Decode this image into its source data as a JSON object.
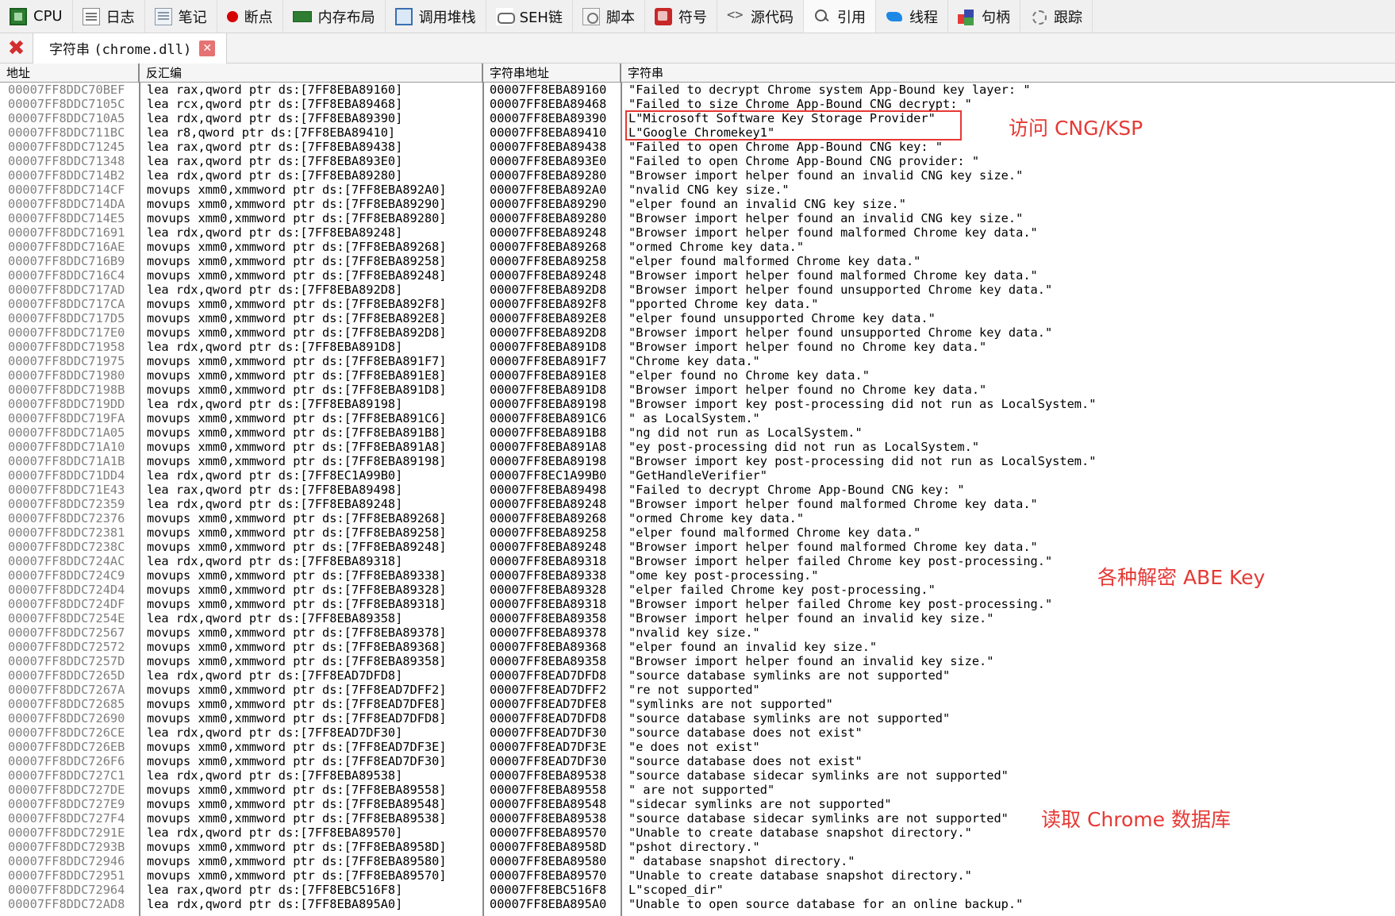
{
  "toolbar": {
    "tabs": [
      {
        "id": "cpu",
        "label": "CPU",
        "icon": "cpu-icon"
      },
      {
        "id": "log",
        "label": "日志",
        "icon": "log-icon"
      },
      {
        "id": "notes",
        "label": "笔记",
        "icon": "notes-icon"
      },
      {
        "id": "breakpoints",
        "label": "断点",
        "icon": "breakpoint-icon"
      },
      {
        "id": "memory",
        "label": "内存布局",
        "icon": "memory-map-icon"
      },
      {
        "id": "callstack",
        "label": "调用堆栈",
        "icon": "callstack-icon"
      },
      {
        "id": "seh",
        "label": "SEH链",
        "icon": "seh-chain-icon"
      },
      {
        "id": "script",
        "label": "脚本",
        "icon": "script-icon"
      },
      {
        "id": "symbols",
        "label": "符号",
        "icon": "symbols-icon"
      },
      {
        "id": "source",
        "label": "源代码",
        "icon": "source-code-icon"
      },
      {
        "id": "references",
        "label": "引用",
        "icon": "references-icon"
      },
      {
        "id": "threads",
        "label": "线程",
        "icon": "threads-icon"
      },
      {
        "id": "handles",
        "label": "句柄",
        "icon": "handles-icon"
      },
      {
        "id": "trace",
        "label": "跟踪",
        "icon": "trace-icon"
      }
    ],
    "active_tab": "references"
  },
  "subtab": {
    "label_prefix": "字符串 ",
    "label_module": "(chrome.dll)"
  },
  "columns": {
    "address": "地址",
    "disassembly": "反汇编",
    "string_address": "字符串地址",
    "string": "字符串"
  },
  "rows": [
    [
      "00007FF8DDC70BEF",
      "lea rax,qword ptr ds:[7FF8EBA89160]",
      "00007FF8EBA89160",
      "\"Failed to decrypt Chrome system App-Bound key layer: \""
    ],
    [
      "00007FF8DDC7105C",
      "lea rcx,qword ptr ds:[7FF8EBA89468]",
      "00007FF8EBA89468",
      "\"Failed to size Chrome App-Bound CNG decrypt: \""
    ],
    [
      "00007FF8DDC710A5",
      "lea rdx,qword ptr ds:[7FF8EBA89390]",
      "00007FF8EBA89390",
      "L\"Microsoft Software Key Storage Provider\""
    ],
    [
      "00007FF8DDC711BC",
      "lea r8,qword ptr ds:[7FF8EBA89410]",
      "00007FF8EBA89410",
      "L\"Google Chromekey1\""
    ],
    [
      "00007FF8DDC71245",
      "lea rax,qword ptr ds:[7FF8EBA89438]",
      "00007FF8EBA89438",
      "\"Failed to open Chrome App-Bound CNG key: \""
    ],
    [
      "00007FF8DDC71348",
      "lea rax,qword ptr ds:[7FF8EBA893E0]",
      "00007FF8EBA893E0",
      "\"Failed to open Chrome App-Bound CNG provider: \""
    ],
    [
      "00007FF8DDC714B2",
      "lea rdx,qword ptr ds:[7FF8EBA89280]",
      "00007FF8EBA89280",
      "\"Browser import helper found an invalid CNG key size.\""
    ],
    [
      "00007FF8DDC714CF",
      "movups xmm0,xmmword ptr ds:[7FF8EBA892A0]",
      "00007FF8EBA892A0",
      "\"nvalid CNG key size.\""
    ],
    [
      "00007FF8DDC714DA",
      "movups xmm0,xmmword ptr ds:[7FF8EBA89290]",
      "00007FF8EBA89290",
      "\"elper found an invalid CNG key size.\""
    ],
    [
      "00007FF8DDC714E5",
      "movups xmm0,xmmword ptr ds:[7FF8EBA89280]",
      "00007FF8EBA89280",
      "\"Browser import helper found an invalid CNG key size.\""
    ],
    [
      "00007FF8DDC71691",
      "lea rdx,qword ptr ds:[7FF8EBA89248]",
      "00007FF8EBA89248",
      "\"Browser import helper found malformed Chrome key data.\""
    ],
    [
      "00007FF8DDC716AE",
      "movups xmm0,xmmword ptr ds:[7FF8EBA89268]",
      "00007FF8EBA89268",
      "\"ormed Chrome key data.\""
    ],
    [
      "00007FF8DDC716B9",
      "movups xmm0,xmmword ptr ds:[7FF8EBA89258]",
      "00007FF8EBA89258",
      "\"elper found malformed Chrome key data.\""
    ],
    [
      "00007FF8DDC716C4",
      "movups xmm0,xmmword ptr ds:[7FF8EBA89248]",
      "00007FF8EBA89248",
      "\"Browser import helper found malformed Chrome key data.\""
    ],
    [
      "00007FF8DDC717AD",
      "lea rdx,qword ptr ds:[7FF8EBA892D8]",
      "00007FF8EBA892D8",
      "\"Browser import helper found unsupported Chrome key data.\""
    ],
    [
      "00007FF8DDC717CA",
      "movups xmm0,xmmword ptr ds:[7FF8EBA892F8]",
      "00007FF8EBA892F8",
      "\"pported Chrome key data.\""
    ],
    [
      "00007FF8DDC717D5",
      "movups xmm0,xmmword ptr ds:[7FF8EBA892E8]",
      "00007FF8EBA892E8",
      "\"elper found unsupported Chrome key data.\""
    ],
    [
      "00007FF8DDC717E0",
      "movups xmm0,xmmword ptr ds:[7FF8EBA892D8]",
      "00007FF8EBA892D8",
      "\"Browser import helper found unsupported Chrome key data.\""
    ],
    [
      "00007FF8DDC71958",
      "lea rdx,qword ptr ds:[7FF8EBA891D8]",
      "00007FF8EBA891D8",
      "\"Browser import helper found no Chrome key data.\""
    ],
    [
      "00007FF8DDC71975",
      "movups xmm0,xmmword ptr ds:[7FF8EBA891F7]",
      "00007FF8EBA891F7",
      "\"Chrome key data.\""
    ],
    [
      "00007FF8DDC71980",
      "movups xmm0,xmmword ptr ds:[7FF8EBA891E8]",
      "00007FF8EBA891E8",
      "\"elper found no Chrome key data.\""
    ],
    [
      "00007FF8DDC7198B",
      "movups xmm0,xmmword ptr ds:[7FF8EBA891D8]",
      "00007FF8EBA891D8",
      "\"Browser import helper found no Chrome key data.\""
    ],
    [
      "00007FF8DDC719DD",
      "lea rdx,qword ptr ds:[7FF8EBA89198]",
      "00007FF8EBA89198",
      "\"Browser import key post-processing did not run as LocalSystem.\""
    ],
    [
      "00007FF8DDC719FA",
      "movups xmm0,xmmword ptr ds:[7FF8EBA891C6]",
      "00007FF8EBA891C6",
      "\" as LocalSystem.\""
    ],
    [
      "00007FF8DDC71A05",
      "movups xmm0,xmmword ptr ds:[7FF8EBA891B8]",
      "00007FF8EBA891B8",
      "\"ng did not run as LocalSystem.\""
    ],
    [
      "00007FF8DDC71A10",
      "movups xmm0,xmmword ptr ds:[7FF8EBA891A8]",
      "00007FF8EBA891A8",
      "\"ey post-processing did not run as LocalSystem.\""
    ],
    [
      "00007FF8DDC71A1B",
      "movups xmm0,xmmword ptr ds:[7FF8EBA89198]",
      "00007FF8EBA89198",
      "\"Browser import key post-processing did not run as LocalSystem.\""
    ],
    [
      "00007FF8DDC71DD4",
      "lea rdx,qword ptr ds:[7FF8EC1A99B0]",
      "00007FF8EC1A99B0",
      "\"GetHandleVerifier\""
    ],
    [
      "00007FF8DDC71E43",
      "lea rax,qword ptr ds:[7FF8EBA89498]",
      "00007FF8EBA89498",
      "\"Failed to decrypt Chrome App-Bound CNG key: \""
    ],
    [
      "00007FF8DDC72359",
      "lea rdx,qword ptr ds:[7FF8EBA89248]",
      "00007FF8EBA89248",
      "\"Browser import helper found malformed Chrome key data.\""
    ],
    [
      "00007FF8DDC72376",
      "movups xmm0,xmmword ptr ds:[7FF8EBA89268]",
      "00007FF8EBA89268",
      "\"ormed Chrome key data.\""
    ],
    [
      "00007FF8DDC72381",
      "movups xmm0,xmmword ptr ds:[7FF8EBA89258]",
      "00007FF8EBA89258",
      "\"elper found malformed Chrome key data.\""
    ],
    [
      "00007FF8DDC7238C",
      "movups xmm0,xmmword ptr ds:[7FF8EBA89248]",
      "00007FF8EBA89248",
      "\"Browser import helper found malformed Chrome key data.\""
    ],
    [
      "00007FF8DDC724AC",
      "lea rdx,qword ptr ds:[7FF8EBA89318]",
      "00007FF8EBA89318",
      "\"Browser import helper failed Chrome key post-processing.\""
    ],
    [
      "00007FF8DDC724C9",
      "movups xmm0,xmmword ptr ds:[7FF8EBA89338]",
      "00007FF8EBA89338",
      "\"ome key post-processing.\""
    ],
    [
      "00007FF8DDC724D4",
      "movups xmm0,xmmword ptr ds:[7FF8EBA89328]",
      "00007FF8EBA89328",
      "\"elper failed Chrome key post-processing.\""
    ],
    [
      "00007FF8DDC724DF",
      "movups xmm0,xmmword ptr ds:[7FF8EBA89318]",
      "00007FF8EBA89318",
      "\"Browser import helper failed Chrome key post-processing.\""
    ],
    [
      "00007FF8DDC7254E",
      "lea rdx,qword ptr ds:[7FF8EBA89358]",
      "00007FF8EBA89358",
      "\"Browser import helper found an invalid key size.\""
    ],
    [
      "00007FF8DDC72567",
      "movups xmm0,xmmword ptr ds:[7FF8EBA89378]",
      "00007FF8EBA89378",
      "\"nvalid key size.\""
    ],
    [
      "00007FF8DDC72572",
      "movups xmm0,xmmword ptr ds:[7FF8EBA89368]",
      "00007FF8EBA89368",
      "\"elper found an invalid key size.\""
    ],
    [
      "00007FF8DDC7257D",
      "movups xmm0,xmmword ptr ds:[7FF8EBA89358]",
      "00007FF8EBA89358",
      "\"Browser import helper found an invalid key size.\""
    ],
    [
      "00007FF8DDC7265D",
      "lea rdx,qword ptr ds:[7FF8EAD7DFD8]",
      "00007FF8EAD7DFD8",
      "\"source database symlinks are not supported\""
    ],
    [
      "00007FF8DDC7267A",
      "movups xmm0,xmmword ptr ds:[7FF8EAD7DFF2]",
      "00007FF8EAD7DFF2",
      "\"re not supported\""
    ],
    [
      "00007FF8DDC72685",
      "movups xmm0,xmmword ptr ds:[7FF8EAD7DFE8]",
      "00007FF8EAD7DFE8",
      "\"symlinks are not supported\""
    ],
    [
      "00007FF8DDC72690",
      "movups xmm0,xmmword ptr ds:[7FF8EAD7DFD8]",
      "00007FF8EAD7DFD8",
      "\"source database symlinks are not supported\""
    ],
    [
      "00007FF8DDC726CE",
      "lea rdx,qword ptr ds:[7FF8EAD7DF30]",
      "00007FF8EAD7DF30",
      "\"source database does not exist\""
    ],
    [
      "00007FF8DDC726EB",
      "movups xmm0,xmmword ptr ds:[7FF8EAD7DF3E]",
      "00007FF8EAD7DF3E",
      "\"e does not exist\""
    ],
    [
      "00007FF8DDC726F6",
      "movups xmm0,xmmword ptr ds:[7FF8EAD7DF30]",
      "00007FF8EAD7DF30",
      "\"source database does not exist\""
    ],
    [
      "00007FF8DDC727C1",
      "lea rdx,qword ptr ds:[7FF8EBA89538]",
      "00007FF8EBA89538",
      "\"source database sidecar symlinks are not supported\""
    ],
    [
      "00007FF8DDC727DE",
      "movups xmm0,xmmword ptr ds:[7FF8EBA89558]",
      "00007FF8EBA89558",
      "\" are not supported\""
    ],
    [
      "00007FF8DDC727E9",
      "movups xmm0,xmmword ptr ds:[7FF8EBA89548]",
      "00007FF8EBA89548",
      "\"sidecar symlinks are not supported\""
    ],
    [
      "00007FF8DDC727F4",
      "movups xmm0,xmmword ptr ds:[7FF8EBA89538]",
      "00007FF8EBA89538",
      "\"source database sidecar symlinks are not supported\""
    ],
    [
      "00007FF8DDC7291E",
      "lea rdx,qword ptr ds:[7FF8EBA89570]",
      "00007FF8EBA89570",
      "\"Unable to create database snapshot directory.\""
    ],
    [
      "00007FF8DDC7293B",
      "movups xmm0,xmmword ptr ds:[7FF8EBA8958D]",
      "00007FF8EBA8958D",
      "\"pshot directory.\""
    ],
    [
      "00007FF8DDC72946",
      "movups xmm0,xmmword ptr ds:[7FF8EBA89580]",
      "00007FF8EBA89580",
      "\" database snapshot directory.\""
    ],
    [
      "00007FF8DDC72951",
      "movups xmm0,xmmword ptr ds:[7FF8EBA89570]",
      "00007FF8EBA89570",
      "\"Unable to create database snapshot directory.\""
    ],
    [
      "00007FF8DDC72964",
      "lea rax,qword ptr ds:[7FF8EBC516F8]",
      "00007FF8EBC516F8",
      "L\"scoped_dir\""
    ],
    [
      "00007FF8DDC72AD8",
      "lea rdx,qword ptr ds:[7FF8EBA895A0]",
      "00007FF8EBA895A0",
      "\"Unable to open source database for an online backup.\""
    ]
  ],
  "annotations": {
    "cng_ksp": "访问 CNG/KSP",
    "abe_key": "各种解密 ABE Key",
    "chrome_db": "读取 Chrome 数据库"
  },
  "colors": {
    "annotation": "#e53935",
    "address_text": "#808080"
  }
}
